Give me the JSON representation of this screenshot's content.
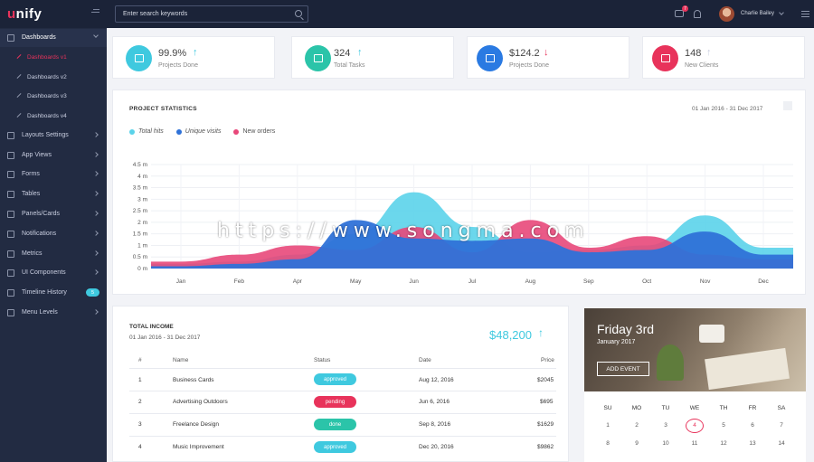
{
  "brand": {
    "first_letter": "u",
    "rest": "nify"
  },
  "search": {
    "placeholder": "Enter search keywords"
  },
  "header": {
    "message_count": "7",
    "user_name": "Charlie Bailey"
  },
  "sidebar": {
    "items": [
      {
        "label": "Dashboards",
        "icon": "dashboard-icon"
      },
      {
        "label": "Layouts Settings",
        "icon": "layout-icon"
      },
      {
        "label": "App Views",
        "icon": "app-icon"
      },
      {
        "label": "Forms",
        "icon": "forms-icon"
      },
      {
        "label": "Tables",
        "icon": "table-icon"
      },
      {
        "label": "Panels/Cards",
        "icon": "panels-icon"
      },
      {
        "label": "Notifications",
        "icon": "bell-icon"
      },
      {
        "label": "Metrics",
        "icon": "metrics-icon"
      },
      {
        "label": "UI Components",
        "icon": "components-icon"
      },
      {
        "label": "Timeline History",
        "icon": "timeline-icon",
        "badge": "5"
      },
      {
        "label": "Menu Levels",
        "icon": "menu-icon"
      }
    ],
    "sub_items": [
      {
        "label": "Dashboards v1",
        "active": true
      },
      {
        "label": "Dashboards v2"
      },
      {
        "label": "Dashboards v3"
      },
      {
        "label": "Dashboards v4"
      }
    ]
  },
  "stats": [
    {
      "value": "99.9%",
      "label": "Projects Done",
      "color": "#3fc9df",
      "arrow": "↑",
      "arrow_color": "#3fc9df"
    },
    {
      "value": "324",
      "label": "Total Tasks",
      "color": "#2bc4a9",
      "arrow": "↑",
      "arrow_color": "#3fc9df"
    },
    {
      "value": "$124.2",
      "label": "Projects Done",
      "color": "#2a7ae2",
      "arrow": "↓",
      "arrow_color": "#e8335b"
    },
    {
      "value": "148",
      "label": "New Clients",
      "color": "#e8335b",
      "arrow": "↑",
      "arrow_color": "#c9cee0"
    }
  ],
  "project_stats": {
    "title": "PROJECT STATISTICS",
    "date_range": "01 Jan 2016 - 31 Dec 2017"
  },
  "chart_data": {
    "type": "area",
    "categories": [
      "Jan",
      "Feb",
      "Apr",
      "May",
      "Jun",
      "Jul",
      "Aug",
      "Sep",
      "Oct",
      "Nov",
      "Dec"
    ],
    "y_tick_labels": [
      "0 m",
      "0.5 m",
      "1 m",
      "1.5 m",
      "2 m",
      "2.5 m",
      "3 m",
      "3.5 m",
      "4 m",
      "4.5 m"
    ],
    "ylim": [
      0,
      4.5
    ],
    "series": [
      {
        "name": "Total hits",
        "color": "#5bd3ea",
        "values": [
          0.2,
          0.3,
          0.6,
          1.5,
          3.3,
          1.8,
          0.7,
          0.8,
          1.0,
          2.3,
          0.9
        ]
      },
      {
        "name": "Unique visits",
        "color": "#2f72d8",
        "values": [
          0.1,
          0.2,
          0.4,
          2.1,
          1.3,
          1.2,
          1.3,
          0.7,
          0.8,
          1.6,
          0.6
        ]
      },
      {
        "name": "New orders",
        "color": "#e8487a",
        "values": [
          0.3,
          0.6,
          1.0,
          0.8,
          1.8,
          0.7,
          2.1,
          0.9,
          1.4,
          0.6,
          0.4
        ]
      }
    ],
    "grid": true,
    "legend": "top-left"
  },
  "income": {
    "title": "TOTAL INCOME",
    "date_range": "01 Jan 2016 - 31 Dec 2017",
    "total": "$48,200",
    "arrow": "↑",
    "headers": {
      "num": "#",
      "name": "Name",
      "status": "Status",
      "date": "Date",
      "price": "Price"
    },
    "rows": [
      {
        "num": "1",
        "name": "Business Cards",
        "status": "approved",
        "status_color": "#3fc9df",
        "date": "Aug 12, 2016",
        "price": "$2045"
      },
      {
        "num": "2",
        "name": "Advertising Outdoors",
        "status": "pending",
        "status_color": "#e8335b",
        "date": "Jun 6, 2016",
        "price": "$695"
      },
      {
        "num": "3",
        "name": "Freelance Design",
        "status": "done",
        "status_color": "#2bc4a9",
        "date": "Sep 8, 2016",
        "price": "$1629"
      },
      {
        "num": "4",
        "name": "Music Improvement",
        "status": "approved",
        "status_color": "#3fc9df",
        "date": "Dec 20, 2016",
        "price": "$9862"
      }
    ]
  },
  "calendar": {
    "day_title": "Friday 3rd",
    "month_title": "January 2017",
    "add_button": "ADD EVENT",
    "weekdays": [
      "SU",
      "MO",
      "TU",
      "WE",
      "TH",
      "FR",
      "SA"
    ],
    "weeks": [
      [
        "1",
        "2",
        "3",
        "4",
        "5",
        "6",
        "7"
      ],
      [
        "8",
        "9",
        "10",
        "11",
        "12",
        "13",
        "14"
      ]
    ],
    "today": "4"
  },
  "watermark": "https://www.songma.com"
}
